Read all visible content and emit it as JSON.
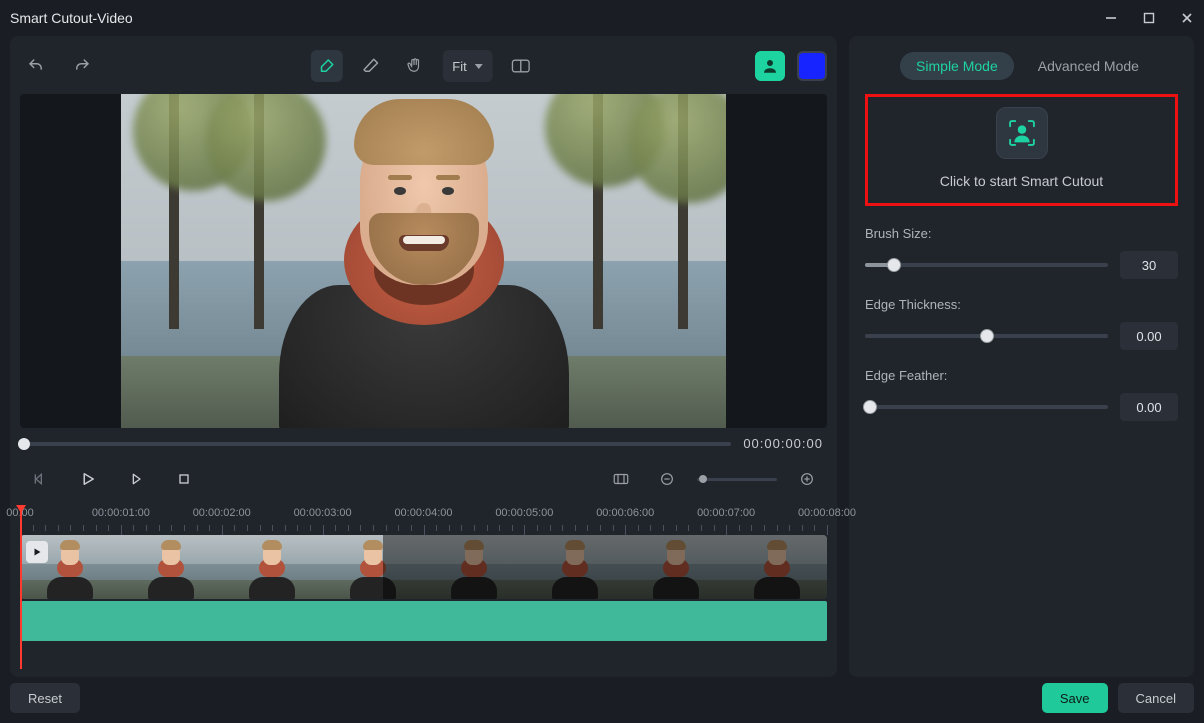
{
  "window": {
    "title": "Smart Cutout-Video"
  },
  "toolbar": {
    "zoom_label": "Fit",
    "bg_color": "#1724ff"
  },
  "preview": {
    "timecode": "00:00:00:00"
  },
  "timeline": {
    "ticks": [
      "00:00",
      "00:00:01:00",
      "00:00:02:00",
      "00:00:03:00",
      "00:00:04:00",
      "00:00:05:00",
      "00:00:06:00",
      "00:00:07:00",
      "00:00:08:00"
    ]
  },
  "panel": {
    "tabs": {
      "simple": "Simple Mode",
      "advanced": "Advanced Mode"
    },
    "cutout_hint": "Click to start Smart Cutout",
    "brush": {
      "label": "Brush Size:",
      "value": "30",
      "pct": 12
    },
    "edge_thickness": {
      "label": "Edge Thickness:",
      "value": "0.00",
      "pct": 50
    },
    "edge_feather": {
      "label": "Edge Feather:",
      "value": "0.00",
      "pct": 0
    }
  },
  "footer": {
    "reset": "Reset",
    "save": "Save",
    "cancel": "Cancel"
  }
}
